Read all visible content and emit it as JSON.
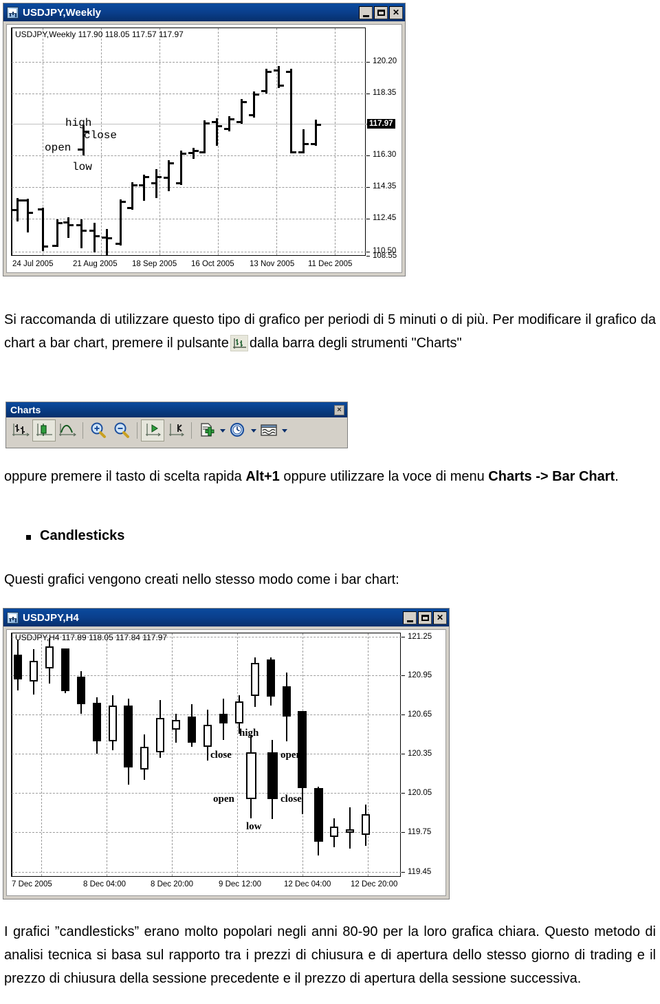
{
  "bar_chart_window": {
    "title": "USDJPY,Weekly",
    "app_icon": "mt4-chart-icon",
    "buttons": {
      "minimize": "_",
      "maximize": "□",
      "close": "×"
    },
    "ohlc_header": "USDJPY,Weekly  117.90 118.05 117.57 117.97",
    "current_price_tag": "117.97",
    "annotations": {
      "high": "high",
      "close": "close",
      "open": "open",
      "low": "low"
    }
  },
  "candle_chart_window": {
    "title": "USDJPY,H4",
    "app_icon": "mt4-chart-icon",
    "buttons": {
      "minimize": "_",
      "maximize": "□",
      "close": "×"
    },
    "ohlc_header": "USDJPY,H4  117.89 118.05 117.84 117.97",
    "annotations": {
      "high": "high",
      "close_left": "close",
      "open_left": "open",
      "open_right": "open",
      "close_right": "close",
      "low": "low"
    }
  },
  "charts_toolbar": {
    "title": "Charts",
    "close_label": "×",
    "buttons": [
      {
        "name": "bar-chart-button",
        "tooltip": "Bar Chart",
        "active": false,
        "dropdown": false
      },
      {
        "name": "candlesticks-button",
        "tooltip": "Candlesticks",
        "active": true,
        "dropdown": false
      },
      {
        "name": "line-chart-button",
        "tooltip": "Line Chart",
        "active": false,
        "dropdown": false
      },
      {
        "name": "zoom-in-button",
        "tooltip": "Zoom In",
        "active": false,
        "dropdown": false
      },
      {
        "name": "zoom-out-button",
        "tooltip": "Zoom Out",
        "active": false,
        "dropdown": false
      },
      {
        "name": "auto-scroll-button",
        "tooltip": "Auto Scroll",
        "active": true,
        "dropdown": false
      },
      {
        "name": "chart-shift-button",
        "tooltip": "Chart Shift",
        "active": false,
        "dropdown": false
      },
      {
        "name": "indicators-button",
        "tooltip": "Indicators",
        "active": false,
        "dropdown": true
      },
      {
        "name": "periods-button",
        "tooltip": "Periods",
        "active": false,
        "dropdown": true
      },
      {
        "name": "templates-button",
        "tooltip": "Templates",
        "active": false,
        "dropdown": true
      }
    ]
  },
  "text": {
    "para1_a": "Si raccomanda di utilizzare questo tipo di grafico per periodi di 5 minuti o di più. Per modificare il grafico da chart a bar chart, premere il pulsante",
    "para1_b": "dalla barra degli strumenti \"Charts\"",
    "para2_a": "oppure premere il tasto di scelta rapida ",
    "para2_shortcut": "Alt+1",
    "para2_b": " oppure utilizzare la voce di menu ",
    "para2_menu": "Charts -> Bar Chart",
    "para2_c": ".",
    "bullet_candlesticks": "Candlesticks",
    "para3": "Questi grafici vengono creati nello stesso modo come i bar chart:",
    "para4": "I grafici ”candlesticks” erano molto popolari negli anni 80-90 per la loro grafica chiara. Questo metodo di analisi tecnica si basa sul rapporto tra i prezzi di chiusura e di apertura dello stesso giorno di trading e il prezzo di chiusura della sessione precedente e il prezzo di apertura della sessione successiva."
  },
  "chart_data": [
    {
      "type": "bar",
      "id": "usdjpy-weekly-barchart",
      "title": "USDJPY,Weekly  117.90 118.05 117.57 117.97",
      "symbol": "USDJPY",
      "timeframe": "Weekly",
      "xlabel": "",
      "ylabel": "",
      "ylim": [
        108.0,
        121.4
      ],
      "grid": true,
      "ytick_labels": [
        "120.20",
        "118.35",
        "116.30",
        "114.35",
        "112.45",
        "110.50",
        "108.55"
      ],
      "ytick_values": [
        120.2,
        118.35,
        116.3,
        114.35,
        112.45,
        110.5,
        108.55
      ],
      "xtick_labels": [
        "24 Jul 2005",
        "21 Aug 2005",
        "18 Sep 2005",
        "16 Oct 2005",
        "13 Nov 2005",
        "11 Dec 2005"
      ],
      "price_line": 117.97,
      "price_tag": "117.97",
      "bars": [
        {
          "open": 111.9,
          "high": 112.6,
          "low": 111.1,
          "close": 112.5
        },
        {
          "open": 112.5,
          "high": 112.6,
          "low": 110.6,
          "close": 111.9
        },
        {
          "open": 111.9,
          "high": 112.3,
          "low": 109.3,
          "close": 109.4
        },
        {
          "open": 109.4,
          "high": 110.8,
          "low": 109.2,
          "close": 110.5
        },
        {
          "open": 110.5,
          "high": 110.9,
          "low": 109.5,
          "close": 110.2
        },
        {
          "open": 110.2,
          "high": 111.2,
          "low": 109.3,
          "close": 109.8
        },
        {
          "open": 109.8,
          "high": 110.8,
          "low": 108.6,
          "close": 109.6
        },
        {
          "open": 109.4,
          "high": 111.4,
          "low": 109.3,
          "close": 111.3
        },
        {
          "open": 111.3,
          "high": 112.5,
          "low": 111.0,
          "close": 112.4
        },
        {
          "open": 112.4,
          "high": 113.6,
          "low": 112.4,
          "close": 113.4
        },
        {
          "open": 113.4,
          "high": 114.0,
          "low": 112.4,
          "close": 113.3
        },
        {
          "open": 113.3,
          "high": 114.2,
          "low": 112.9,
          "close": 113.9
        },
        {
          "open": 113.9,
          "high": 116.3,
          "low": 113.8,
          "close": 116.2
        },
        {
          "open": 116.2,
          "high": 116.5,
          "low": 114.9,
          "close": 116.2
        },
        {
          "open": 116.2,
          "high": 116.4,
          "low": 115.9,
          "close": 116.3
        },
        {
          "open": 116.3,
          "high": 118.0,
          "low": 116.2,
          "close": 117.8
        },
        {
          "open": 117.8,
          "high": 118.3,
          "low": 116.9,
          "close": 117.6
        },
        {
          "open": 117.6,
          "high": 118.1,
          "low": 117.5,
          "close": 118.0
        },
        {
          "open": 118.0,
          "high": 119.5,
          "low": 117.5,
          "close": 119.2
        },
        {
          "open": 119.2,
          "high": 120.4,
          "low": 118.6,
          "close": 120.0
        },
        {
          "open": 120.2,
          "high": 120.6,
          "low": 119.4,
          "close": 120.3
        },
        {
          "open": 120.3,
          "high": 120.4,
          "low": 116.2,
          "close": 116.3
        },
        {
          "open": 116.3,
          "high": 117.3,
          "low": 116.2,
          "close": 116.8
        },
        {
          "open": 117.0,
          "high": 118.2,
          "low": 116.5,
          "close": 117.97
        }
      ]
    },
    {
      "type": "candlestick",
      "id": "usdjpy-h4-candlechart",
      "title": "USDJPY,H4  117.89 118.05 117.84 117.97",
      "symbol": "USDJPY",
      "timeframe": "H4",
      "xlabel": "",
      "ylabel": "",
      "ylim": [
        119.38,
        121.32
      ],
      "grid": true,
      "ytick_labels": [
        "121.25",
        "120.95",
        "120.65",
        "120.35",
        "120.05",
        "119.75",
        "119.45"
      ],
      "ytick_values": [
        121.25,
        120.95,
        120.65,
        120.35,
        120.05,
        119.75,
        119.45
      ],
      "xtick_labels": [
        "7 Dec 2005",
        "8 Dec 04:00",
        "8 Dec 20:00",
        "9 Dec 12:00",
        "12 Dec 04:00",
        "12 Dec 20:00"
      ],
      "candles": [
        {
          "open": 121.25,
          "high": 121.28,
          "low": 120.86,
          "close": 120.97,
          "dir": "down"
        },
        {
          "open": 120.99,
          "high": 121.08,
          "low": 120.83,
          "close": 120.92,
          "dir": "up"
        },
        {
          "open": 120.95,
          "high": 121.22,
          "low": 120.9,
          "close": 121.08,
          "dir": "up"
        },
        {
          "open": 121.1,
          "high": 121.14,
          "low": 120.82,
          "close": 120.85,
          "dir": "down"
        },
        {
          "open": 120.82,
          "high": 120.86,
          "low": 120.63,
          "close": 120.7,
          "dir": "down"
        },
        {
          "open": 120.69,
          "high": 120.74,
          "low": 120.4,
          "close": 120.48,
          "dir": "down"
        },
        {
          "open": 120.47,
          "high": 120.77,
          "low": 120.46,
          "close": 120.67,
          "dir": "up"
        },
        {
          "open": 120.68,
          "high": 120.7,
          "low": 120.13,
          "close": 120.37,
          "dir": "down"
        },
        {
          "open": 120.3,
          "high": 120.34,
          "low": 120.21,
          "close": 120.4,
          "dir": "up"
        },
        {
          "open": 120.4,
          "high": 120.72,
          "low": 120.35,
          "close": 120.57,
          "dir": "up"
        },
        {
          "open": 120.58,
          "high": 120.62,
          "low": 120.43,
          "close": 120.5,
          "dir": "down"
        },
        {
          "open": 120.5,
          "high": 120.62,
          "low": 120.34,
          "close": 120.45,
          "dir": "up"
        },
        {
          "open": 120.46,
          "high": 120.6,
          "low": 120.44,
          "close": 120.52,
          "dir": "down"
        },
        {
          "open": 120.52,
          "high": 120.72,
          "low": 120.5,
          "close": 120.66,
          "dir": "up"
        },
        {
          "open": 120.7,
          "high": 121.02,
          "low": 120.63,
          "close": 120.93,
          "dir": "up"
        },
        {
          "open": 120.95,
          "high": 121.03,
          "low": 120.78,
          "close": 120.83,
          "dir": "down"
        },
        {
          "open": 120.84,
          "high": 120.94,
          "low": 120.58,
          "close": 120.65,
          "dir": "down"
        },
        {
          "open": 120.65,
          "high": 120.66,
          "low": 120.04,
          "close": 120.05,
          "dir": "down"
        },
        {
          "open": 120.05,
          "high": 120.06,
          "low": 119.64,
          "close": 119.74,
          "dir": "down"
        },
        {
          "open": 119.74,
          "high": 119.8,
          "low": 119.7,
          "close": 119.77,
          "dir": "up"
        },
        {
          "open": 119.78,
          "high": 119.92,
          "low": 119.7,
          "close": 119.78,
          "dir": "up"
        },
        {
          "open": 119.78,
          "high": 119.96,
          "low": 119.73,
          "close": 119.87,
          "dir": "up"
        }
      ]
    }
  ]
}
